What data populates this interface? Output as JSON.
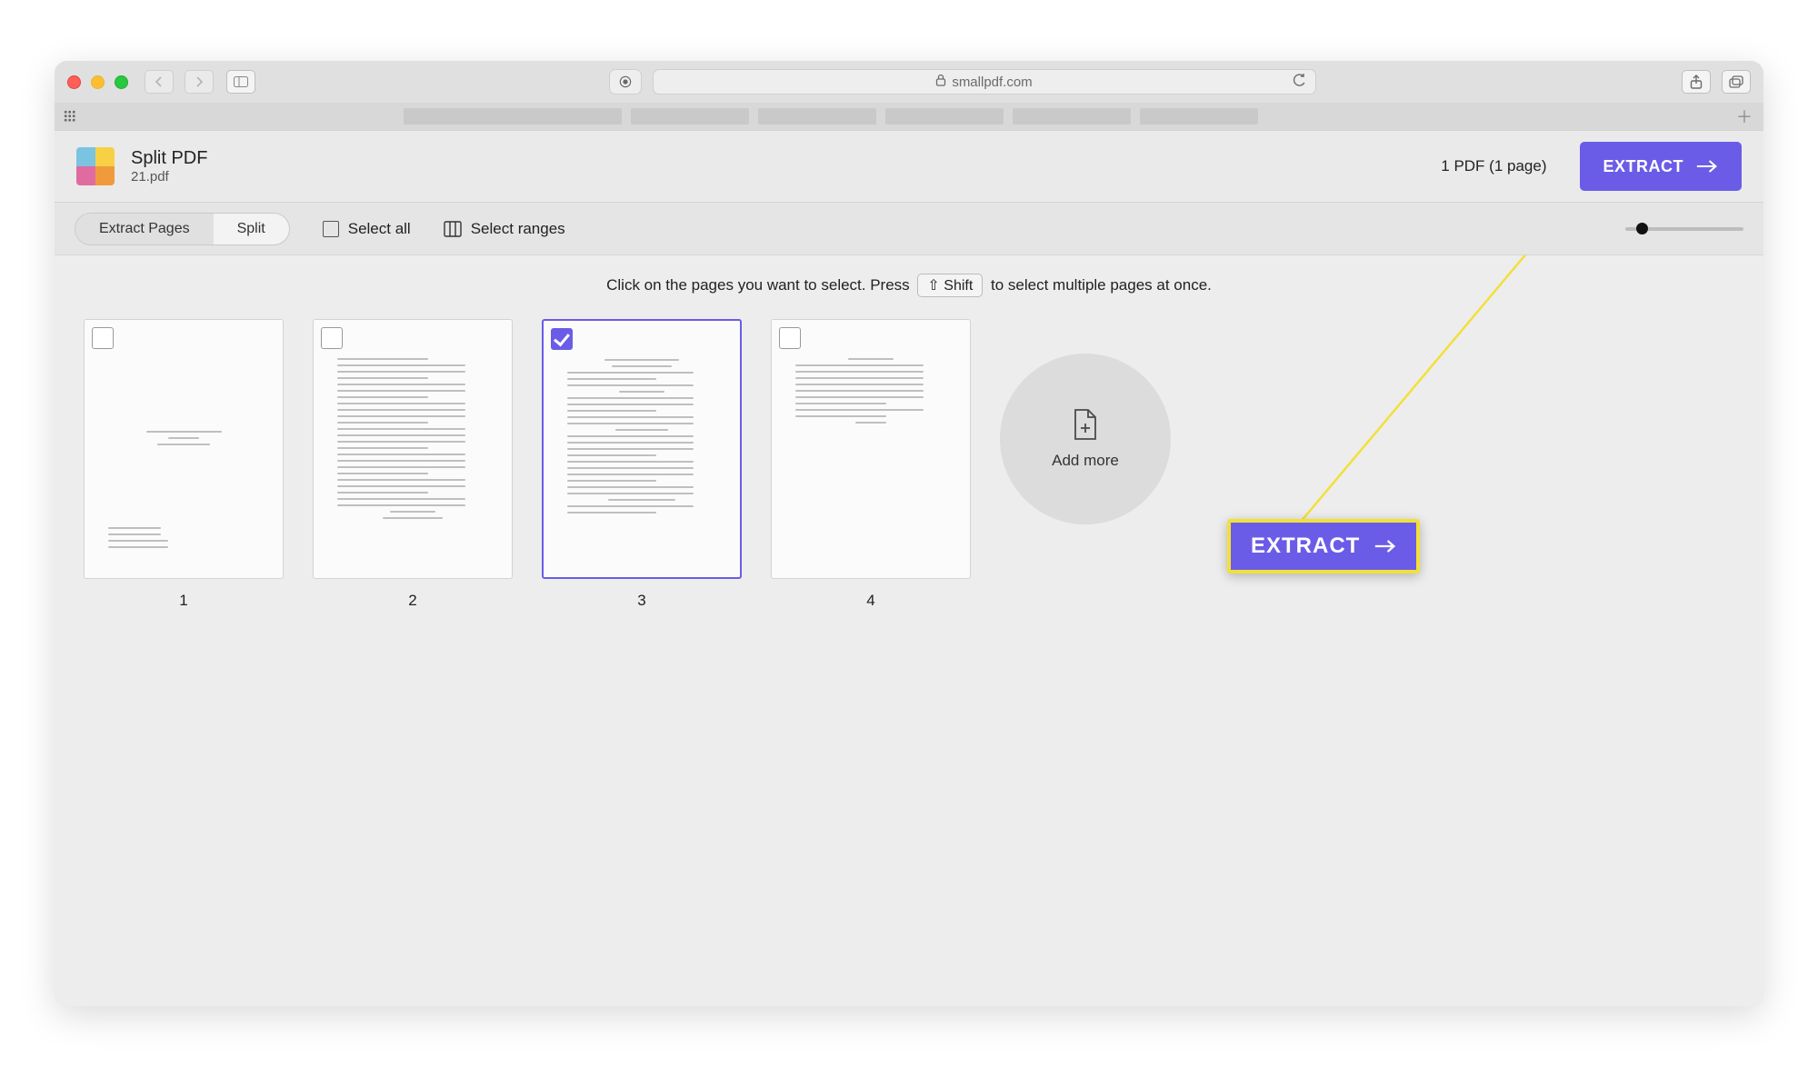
{
  "browser": {
    "url_host": "smallpdf.com"
  },
  "header": {
    "title": "Split PDF",
    "filename": "21.pdf",
    "summary": "1 PDF (1 page)",
    "extract_label": "EXTRACT"
  },
  "toolbar": {
    "seg_extract": "Extract Pages",
    "seg_split": "Split",
    "select_all": "Select all",
    "select_ranges": "Select ranges"
  },
  "hint": {
    "pre": "Click on the pages you want to select. Press",
    "key": "Shift",
    "post": "to select multiple pages at once."
  },
  "pages": {
    "list": [
      {
        "num": "1",
        "selected": false
      },
      {
        "num": "2",
        "selected": false
      },
      {
        "num": "3",
        "selected": true
      },
      {
        "num": "4",
        "selected": false
      }
    ],
    "add_more": "Add more"
  },
  "callout": {
    "label": "EXTRACT"
  },
  "kbd_icon": "⇧"
}
